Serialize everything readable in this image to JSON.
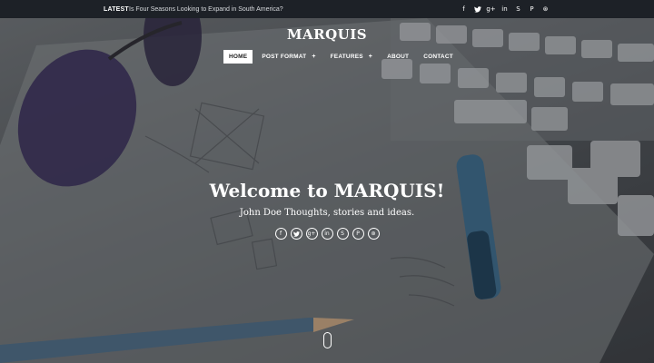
{
  "topbar": {
    "latest_label": "LATEST",
    "latest_headline": "Is Four Seasons Looking to Expand in South America?",
    "social": [
      "facebook-icon",
      "twitter-icon",
      "google-plus-icon",
      "linkedin-icon",
      "skype-icon",
      "pinterest-icon",
      "dribbble-icon"
    ]
  },
  "header": {
    "logo": "MARQUIS"
  },
  "nav": {
    "items": [
      {
        "label": "HOME",
        "active": true
      },
      {
        "label": "POST FORMAT",
        "has_submenu": true
      },
      {
        "label": "FEATURES",
        "has_submenu": true
      },
      {
        "label": "ABOUT"
      },
      {
        "label": "CONTACT"
      }
    ],
    "submenu_symbol": "+"
  },
  "hero": {
    "title": "Welcome to MARQUIS!",
    "tagline": "John Doe Thoughts, stories and ideas.",
    "social": [
      "facebook-icon",
      "twitter-icon",
      "google-plus-icon",
      "linkedin-icon",
      "skype-icon",
      "pinterest-icon",
      "dribbble-icon"
    ]
  },
  "icons": {
    "facebook": "f",
    "twitter": "🐦",
    "google_plus": "g+",
    "linkedin": "in",
    "skype": "S",
    "pinterest": "P",
    "dribbble": "⊛"
  }
}
